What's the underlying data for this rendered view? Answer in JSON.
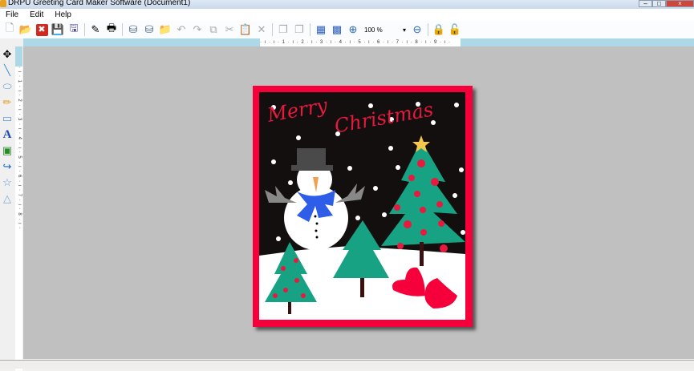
{
  "window": {
    "title": "DRPU Greeting Card Maker Software  (Document1)",
    "controls": [
      "minimize",
      "maximize",
      "close"
    ]
  },
  "menu": [
    "File",
    "Edit",
    "Help"
  ],
  "toolbar": {
    "zoom_value": "100 %",
    "buttons": [
      "new",
      "open",
      "close",
      "save",
      "save-as",
      "edit",
      "print",
      "database-import",
      "database",
      "open-folder",
      "undo",
      "redo",
      "copy",
      "cut",
      "paste",
      "delete",
      "bring-front",
      "send-back",
      "grid",
      "grid-dots",
      "zoom-in",
      "zoom-out",
      "lock",
      "unlock"
    ]
  },
  "ruler": {
    "h": "· ı · ı · 1 · ı · 2 · ı · 3 · ı · 4 · ı · 5 · ı · 6 · ı · 7 · ı · 8 · ı · 9 · ı ·",
    "v": "· ı · 1 · ı · 2 · ı · 3 · ı · 4 · ı · 5 · ı · 6 · ı · 7 · ı · 8 · ı ·"
  },
  "tools": [
    "select",
    "line",
    "ellipse",
    "pencil",
    "rectangle",
    "text",
    "image",
    "curve",
    "star",
    "triangle"
  ],
  "card": {
    "greeting": "Merry Christmas",
    "colors": {
      "border": "#f5003a",
      "sky": "#140f0f",
      "tree": "#17a383",
      "snow": "#ffffff",
      "heart": "#f5003a",
      "scarf": "#2e5ee8"
    }
  }
}
